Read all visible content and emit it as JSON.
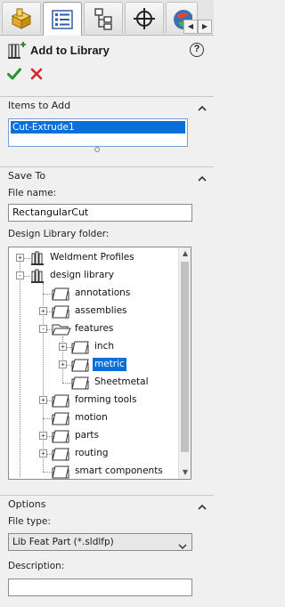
{
  "tabs": [
    {
      "icon": "part-feature-icon"
    },
    {
      "icon": "property-manager-icon",
      "active": true
    },
    {
      "icon": "configuration-manager-icon"
    },
    {
      "icon": "dimxpert-crosshair-icon"
    },
    {
      "icon": "appearance-icon"
    }
  ],
  "header": {
    "title": "Add to Library",
    "help": "?"
  },
  "items_to_add": {
    "title": "Items to Add",
    "items": [
      "Cut-Extrude1"
    ]
  },
  "save_to": {
    "title": "Save To",
    "file_name_label": "File name:",
    "file_name_value": "RectangularCut",
    "folder_label": "Design Library folder:",
    "tree": [
      {
        "label": "Weldment Profiles",
        "level": 0,
        "icon": "library-folder-icon",
        "expander": "+"
      },
      {
        "label": "design library",
        "level": 0,
        "icon": "library-folder-icon",
        "expander": "-"
      },
      {
        "label": "annotations",
        "level": 1,
        "icon": "folder-icon",
        "expander": ""
      },
      {
        "label": "assemblies",
        "level": 1,
        "icon": "folder-icon",
        "expander": "+"
      },
      {
        "label": "features",
        "level": 1,
        "icon": "folder-open-icon",
        "expander": "-"
      },
      {
        "label": "inch",
        "level": 2,
        "icon": "folder-icon",
        "expander": "+"
      },
      {
        "label": "metric",
        "level": 2,
        "icon": "folder-icon",
        "expander": "+",
        "selected": true
      },
      {
        "label": "Sheetmetal",
        "level": 2,
        "icon": "folder-icon",
        "expander": ""
      },
      {
        "label": "forming tools",
        "level": 1,
        "icon": "folder-icon",
        "expander": "+"
      },
      {
        "label": "motion",
        "level": 1,
        "icon": "folder-icon",
        "expander": ""
      },
      {
        "label": "parts",
        "level": 1,
        "icon": "folder-icon",
        "expander": "+"
      },
      {
        "label": "routing",
        "level": 1,
        "icon": "folder-icon",
        "expander": "+"
      },
      {
        "label": "smart components",
        "level": 1,
        "icon": "folder-icon",
        "expander": ""
      }
    ]
  },
  "options": {
    "title": "Options",
    "file_type_label": "File type:",
    "file_type_value": "Lib Feat Part (*.sldlfp)",
    "description_label": "Description:",
    "description_value": ""
  },
  "colors": {
    "selection": "#0a6fd8",
    "ok_green": "#1f9a2a",
    "cancel_red": "#d8262a",
    "icon_yellow": "#e9b92b"
  }
}
